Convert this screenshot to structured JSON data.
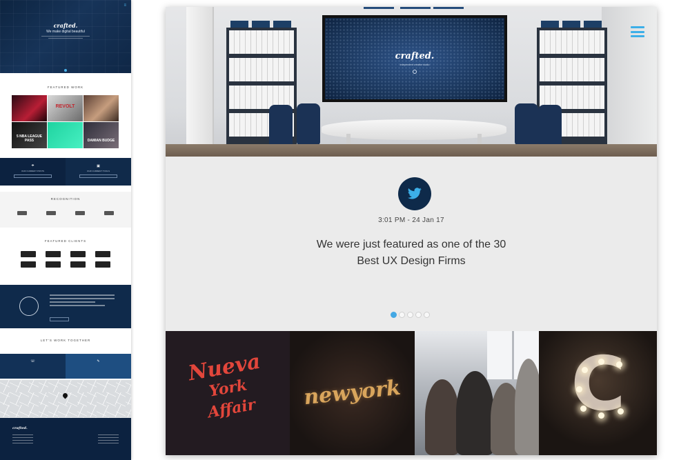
{
  "thumbnail": {
    "logo": "crafted.",
    "tagline": "We make digital beautiful",
    "featured_title": "FEATURED WORK",
    "work_tiles": [
      "",
      "REVOLT",
      "",
      "5 NBA LEAGUE PASS",
      "",
      "DAMIAN BUDGE"
    ],
    "contact_left": "OUR CURRENT POSTS",
    "contact_right": "OUR CURRENT TOOLS",
    "recognition_title": "RECOGNITION",
    "clients_title": "FEATURED CLIENTS",
    "lets_work_title": "LET'S WORK TOGETHER",
    "contact2_left": "NEW BUSINESS",
    "contact2_right": "JOIN OUR TEAM",
    "footer_logo": "crafted."
  },
  "hero": {
    "tv_logo": "crafted.",
    "tv_sub": "independent creative studio",
    "menu_icon": "hamburger-menu-icon"
  },
  "feature": {
    "icon": "twitter-bird-icon",
    "timestamp": "3:01 PM - 24 Jan 17",
    "tweet_line1": "We were just featured as one of the 30",
    "tweet_line2": "Best UX Design Firms",
    "pagination_count": 5,
    "active_index": 0
  },
  "gallery": {
    "tile1_text_a": "Nueva",
    "tile1_text_b": "York",
    "tile1_text_c": "Affair",
    "tile2_text": "newyork",
    "tile4_text": "C"
  },
  "colors": {
    "navy": "#0e2a4a",
    "accent_blue": "#3cafe8",
    "panel_grey": "#ebebeb"
  }
}
